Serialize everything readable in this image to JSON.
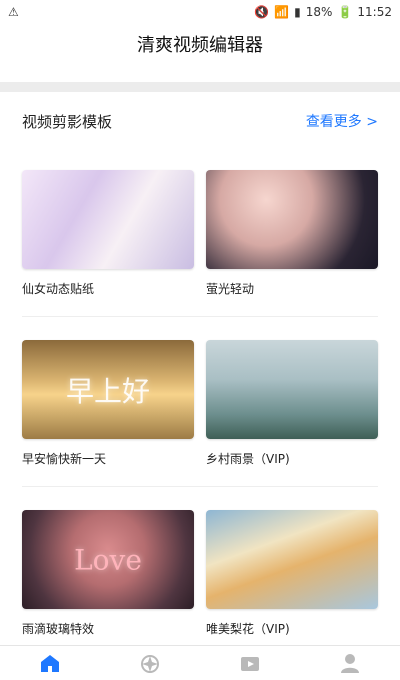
{
  "statusbar": {
    "left_icon": "warning-icon",
    "right_text": "18%",
    "time": "11:52"
  },
  "appbar": {
    "title": "清爽视频编辑器"
  },
  "section": {
    "title": "视频剪影模板",
    "more": "查看更多 >"
  },
  "templates": [
    {
      "label": "仙女动态贴纸"
    },
    {
      "label": "萤光轻动"
    },
    {
      "label": "早安愉快新一天",
      "overlay": "早上好"
    },
    {
      "label": "乡村雨景（VIP)"
    },
    {
      "label": "雨滴玻璃特效",
      "overlay": "Love"
    },
    {
      "label": "唯美梨花（VIP)"
    }
  ],
  "bottom_nav": [
    "home-icon",
    "magic-icon",
    "video-icon",
    "user-icon"
  ],
  "colors": {
    "accent": "#1f78ff"
  }
}
